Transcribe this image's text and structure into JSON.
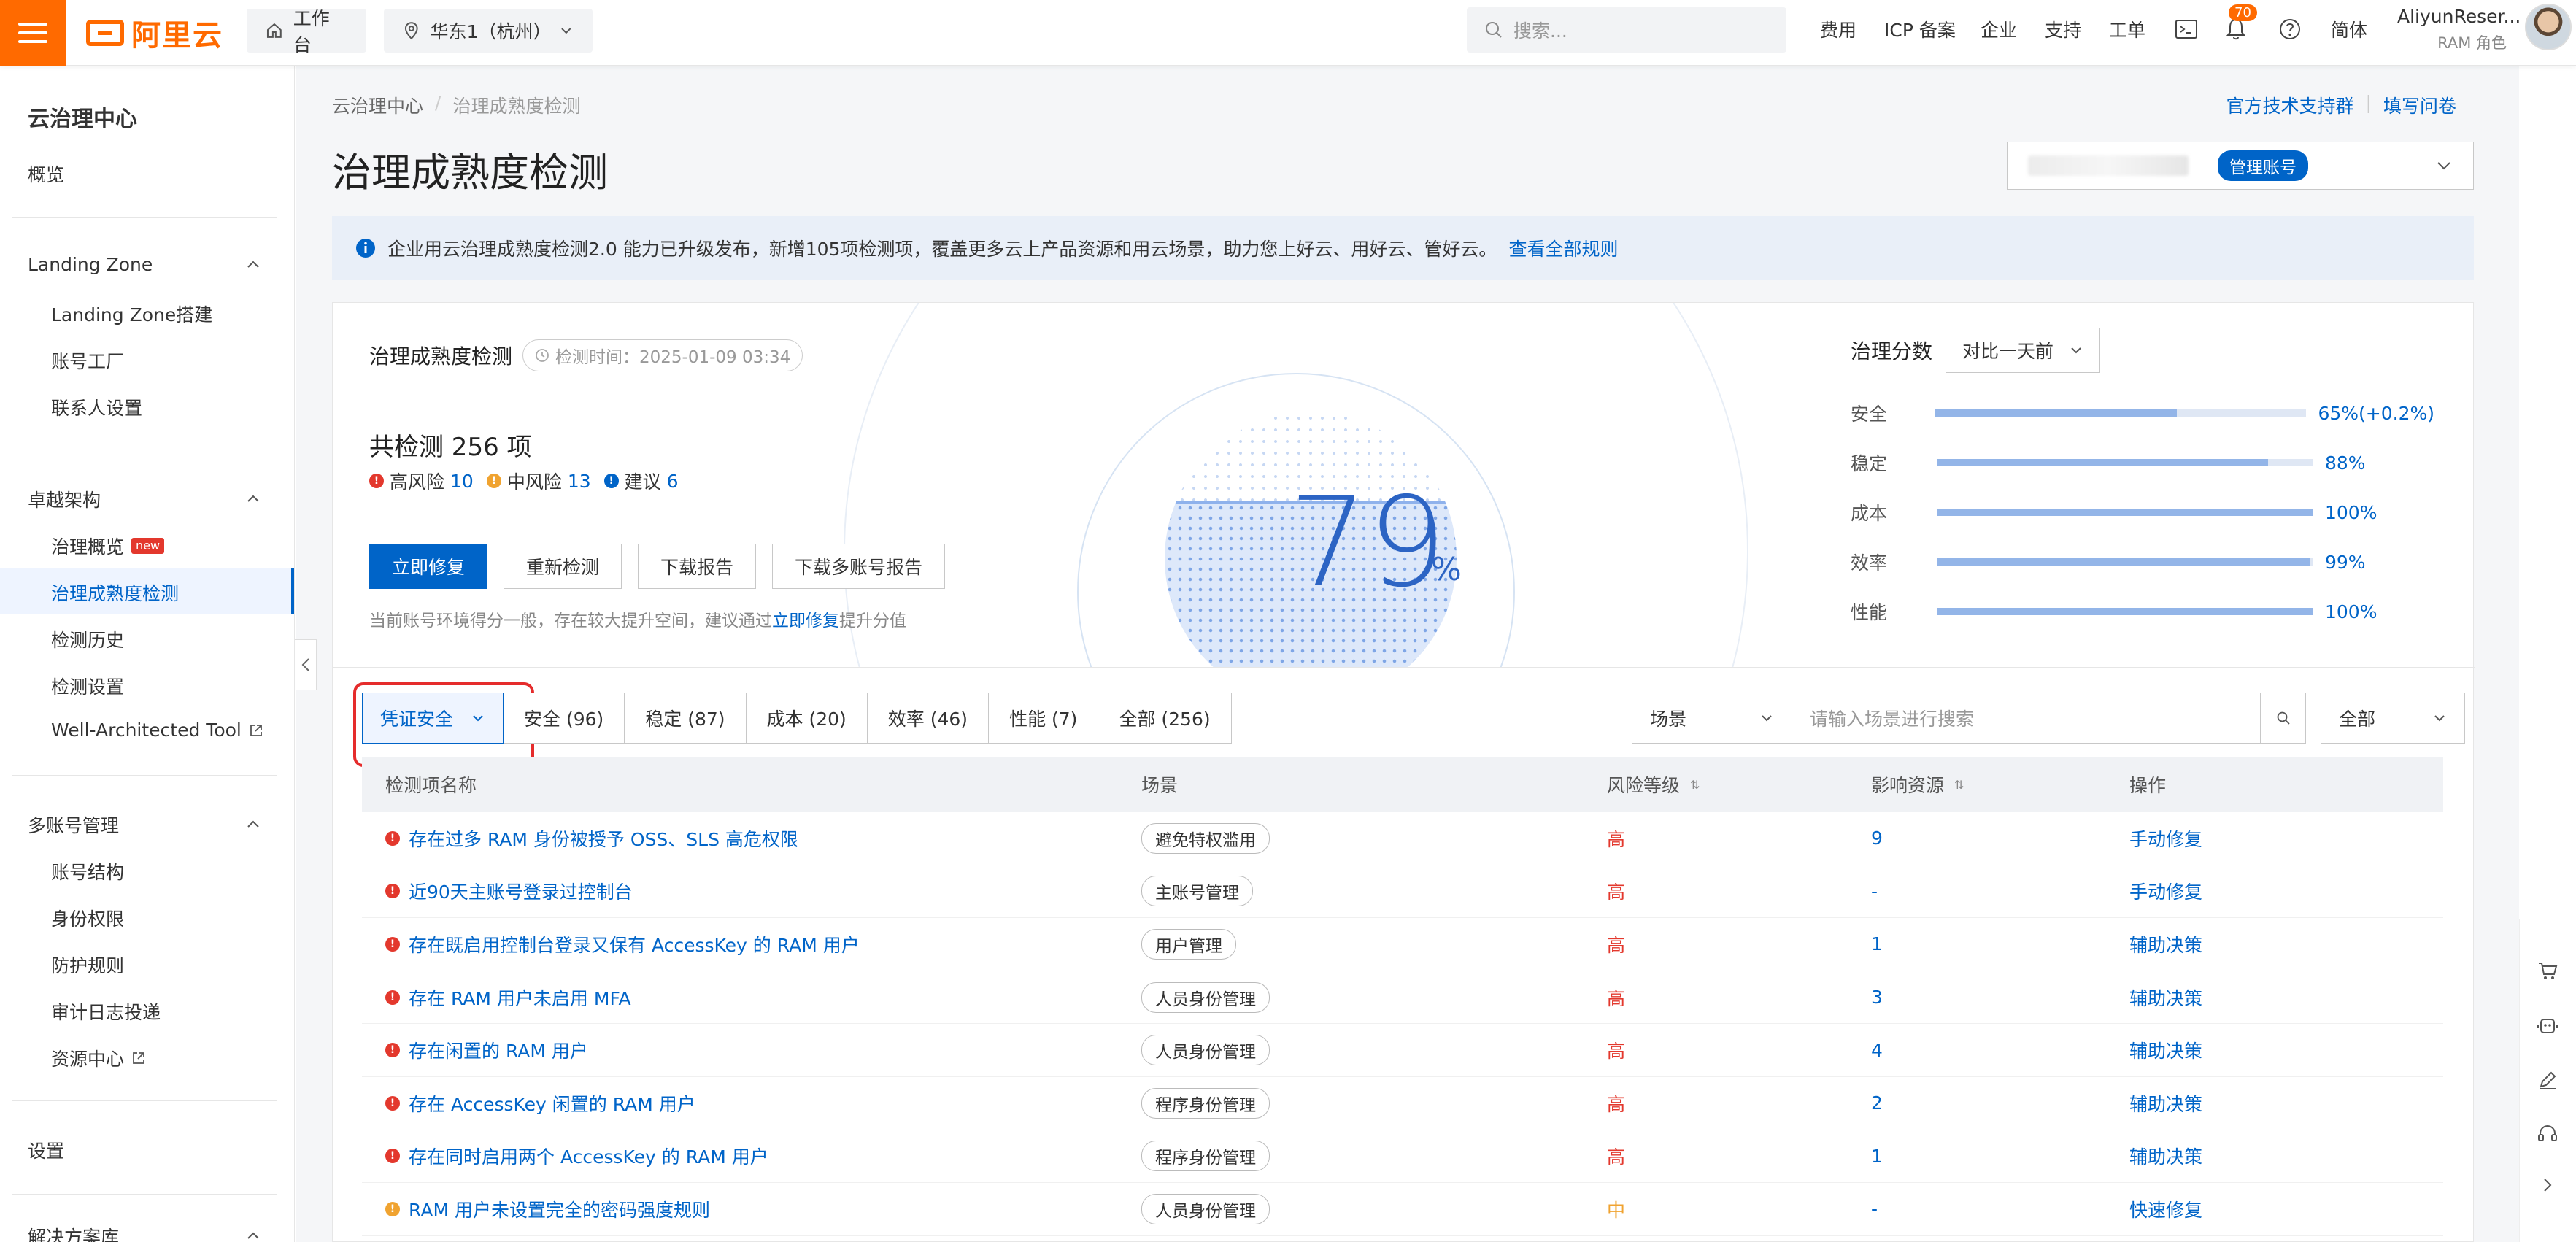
{
  "colors": {
    "brand": "#ff6a00",
    "primary": "#0064c8",
    "high": "#e3382d",
    "medium": "#f0a330",
    "highlight": "#e52c2c"
  },
  "topbar": {
    "logo_text": "阿里云",
    "workbench": "工作台",
    "region": "华东1（杭州）",
    "search_placeholder": "搜索...",
    "nav": [
      "费用",
      "ICP 备案",
      "企业",
      "支持",
      "工单"
    ],
    "notification_count": "70",
    "language": "简体",
    "user_name": "AliyunReser...",
    "user_role": "RAM 角色"
  },
  "sidebar": {
    "title": "云治理中心",
    "overview": "概览",
    "groups": [
      {
        "label": "Landing Zone",
        "items": [
          "Landing Zone搭建",
          "账号工厂",
          "联系人设置"
        ]
      },
      {
        "label": "卓越架构",
        "items": [
          "治理概览",
          "治理成熟度检测",
          "检测历史",
          "检测设置",
          "Well-Architected Tool"
        ]
      },
      {
        "label": "多账号管理",
        "items": [
          "账号结构",
          "身份权限",
          "防护规则",
          "审计日志投递",
          "资源中心"
        ]
      }
    ],
    "new_tag": "new",
    "settings": "设置",
    "solutions": "解决方案库"
  },
  "header": {
    "breadcrumb": [
      "云治理中心",
      "治理成熟度检测"
    ],
    "links": [
      "官方技术支持群",
      "填写问卷"
    ],
    "title": "治理成熟度检测",
    "account_tag": "管理账号"
  },
  "notice": {
    "text": "企业用云治理成熟度检测2.0 能力已升级发布，新增105项检测项，覆盖更多云上产品资源和用云场景，助力您上好云、用好云、管好云。",
    "link": "查看全部规则"
  },
  "summary": {
    "title": "治理成熟度检测",
    "check_time": "检测时间：2025-01-09 03:34",
    "total": "共检测 256 项",
    "high_label": "高风险",
    "high_count": "10",
    "medium_label": "中风险",
    "medium_count": "13",
    "advice_label": "建议",
    "advice_count": "6",
    "buttons": [
      "立即修复",
      "重新检测",
      "下载报告",
      "下载多账号报告"
    ],
    "hint_pre": "当前账号环境得分一般，存在较大提升空间，建议通过",
    "hint_link": "立即修复",
    "hint_post": "提升分值",
    "score": "79",
    "score_unit": "%",
    "score_value": 0.79
  },
  "governance": {
    "title": "治理分数",
    "compare": "对比一天前",
    "metrics": [
      {
        "label": "安全",
        "value": "65%(+0.2%)",
        "fraction": 0.65
      },
      {
        "label": "稳定",
        "value": "88%",
        "fraction": 0.88
      },
      {
        "label": "成本",
        "value": "100%",
        "fraction": 1.0
      },
      {
        "label": "效率",
        "value": "99%",
        "fraction": 0.99
      },
      {
        "label": "性能",
        "value": "100%",
        "fraction": 1.0
      }
    ]
  },
  "filters": {
    "category": "凭证安全",
    "tabs": [
      "安全 (96)",
      "稳定 (87)",
      "成本 (20)",
      "效率 (46)",
      "性能 (7)",
      "全部 (256)"
    ],
    "scene_select": "场景",
    "scene_placeholder": "请输入场景进行搜索",
    "all_select": "全部"
  },
  "table": {
    "headers": [
      "检测项名称",
      "场景",
      "风险等级",
      "影响资源",
      "操作"
    ],
    "rows": [
      {
        "name": "存在过多 RAM 身份被授予 OSS、SLS 高危权限",
        "scene": "避免特权滥用",
        "risk": "高",
        "resources": "9",
        "action": "手动修复",
        "level": "high"
      },
      {
        "name": "近90天主账号登录过控制台",
        "scene": "主账号管理",
        "risk": "高",
        "resources": "-",
        "action": "手动修复",
        "level": "high"
      },
      {
        "name": "存在既启用控制台登录又保有 AccessKey 的 RAM 用户",
        "scene": "用户管理",
        "risk": "高",
        "resources": "1",
        "action": "辅助决策",
        "level": "high"
      },
      {
        "name": "存在 RAM 用户未启用 MFA",
        "scene": "人员身份管理",
        "risk": "高",
        "resources": "3",
        "action": "辅助决策",
        "level": "high"
      },
      {
        "name": "存在闲置的 RAM 用户",
        "scene": "人员身份管理",
        "risk": "高",
        "resources": "4",
        "action": "辅助决策",
        "level": "high"
      },
      {
        "name": "存在 AccessKey 闲置的 RAM 用户",
        "scene": "程序身份管理",
        "risk": "高",
        "resources": "2",
        "action": "辅助决策",
        "level": "high"
      },
      {
        "name": "存在同时启用两个 AccessKey 的 RAM 用户",
        "scene": "程序身份管理",
        "risk": "高",
        "resources": "1",
        "action": "辅助决策",
        "level": "high"
      },
      {
        "name": "RAM 用户未设置完全的密码强度规则",
        "scene": "人员身份管理",
        "risk": "中",
        "resources": "-",
        "action": "快速修复",
        "level": "medium"
      }
    ]
  }
}
